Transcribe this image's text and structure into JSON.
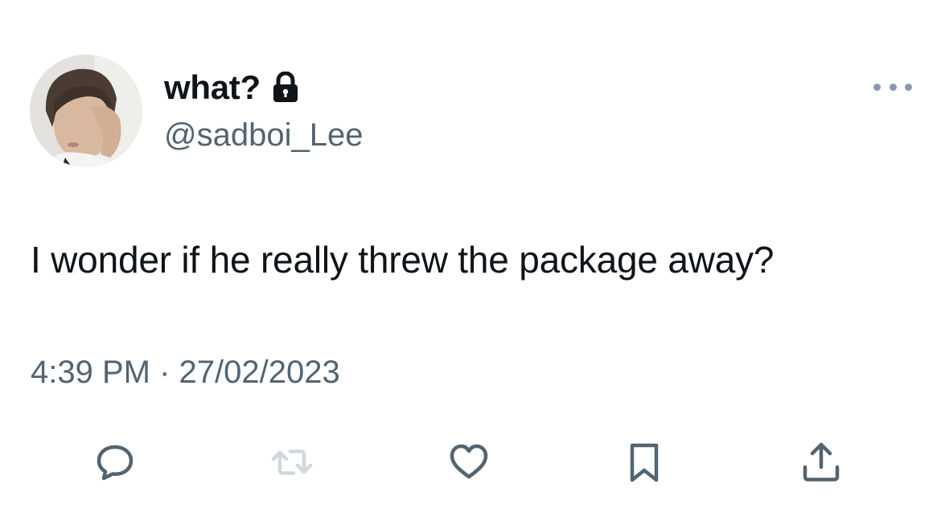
{
  "tweet": {
    "display_name": "what?",
    "handle": "@sadboi_Lee",
    "verified_protected_icon": "lock-icon",
    "text": "I wonder if he really threw the package away?",
    "timestamp": "4:39 PM · 27/02/2023"
  },
  "actions": [
    {
      "name": "reply",
      "icon": "speech-bubble-icon"
    },
    {
      "name": "retweet",
      "icon": "retweet-icon",
      "state": "disabled"
    },
    {
      "name": "like",
      "icon": "heart-icon"
    },
    {
      "name": "bookmark",
      "icon": "bookmark-icon"
    },
    {
      "name": "share",
      "icon": "share-icon"
    }
  ],
  "colors": {
    "text_primary": "#0f1419",
    "text_secondary": "#536471",
    "icon": "#536471",
    "icon_disabled": "#cfd9de",
    "background": "#ffffff"
  }
}
